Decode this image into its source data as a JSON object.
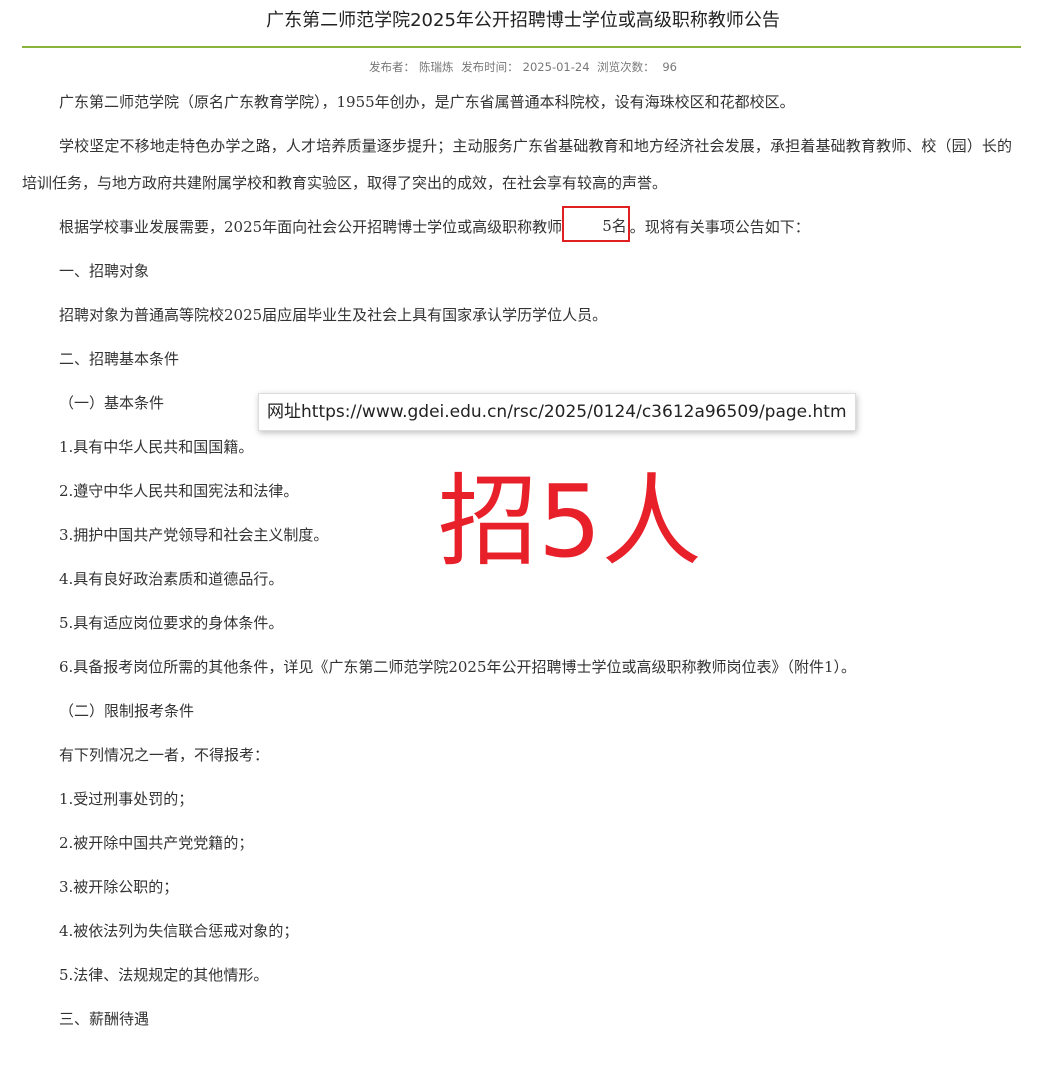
{
  "article": {
    "title": "广东第二师范学院2025年公开招聘博士学位或高级职称教师公告",
    "meta": {
      "publisher_label": "发布者：",
      "publisher": "陈瑞炼",
      "time_label": "发布时间：",
      "time": "2025-01-24",
      "views_label": "浏览次数：",
      "views": "96"
    },
    "paragraphs": {
      "p1": "广东第二师范学院（原名广东教育学院），1955年创办，是广东省属普通本科院校，设有海珠校区和花都校区。",
      "p2": "学校坚定不移地走特色办学之路，人才培养质量逐步提升；主动服务广东省基础教育和地方经济社会发展，承担着基础教育教师、校（园）长的培训任务，与地方政府共建附属学校和教育实验区，取得了突出的成效，在社会享有较高的声誉。",
      "p3_before": "根据学校事业发展需要，2025年面向社会公开招聘博士学位或高级职称教师",
      "p3_highlight": "5名",
      "p3_after": "。现将有关事项公告如下：",
      "s1_heading": "一、招聘对象",
      "s1_text": "招聘对象为普通高等院校2025届应届毕业生及社会上具有国家承认学历学位人员。",
      "s2_heading": "二、招聘基本条件",
      "s2_sub1": "（一）基本条件",
      "c1": "1.具有中华人民共和国国籍。",
      "c2": "2.遵守中华人民共和国宪法和法律。",
      "c3": "3.拥护中国共产党领导和社会主义制度。",
      "c4": "4.具有良好政治素质和道德品行。",
      "c5": "5.具有适应岗位要求的身体条件。",
      "c6": "6.具备报考岗位所需的其他条件，详见《广东第二师范学院2025年公开招聘博士学位或高级职称教师岗位表》（附件1）。",
      "s2_sub2": "（二）限制报考条件",
      "r_intro": "有下列情况之一者，不得报考：",
      "r1": "1.受过刑事处罚的；",
      "r2": "2.被开除中国共产党党籍的；",
      "r3": "3.被开除公职的；",
      "r4": "4.被依法列为失信联合惩戒对象的；",
      "r5": "5.法律、法规规定的其他情形。",
      "s3_heading": "三、薪酬待遇"
    }
  },
  "annotations": {
    "url_tooltip": "网址https://www.gdei.edu.cn/rsc/2025/0124/c3612a96509/page.htm",
    "overlay_text": "招5人",
    "highlight_color": "#e02020",
    "overlay_color": "#e8202a"
  },
  "theme": {
    "divider_color": "#8ab33c"
  }
}
